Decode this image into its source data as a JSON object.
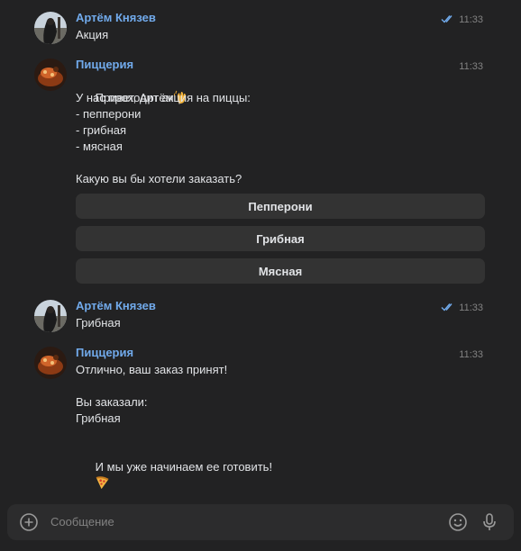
{
  "chat": {
    "messages": [
      {
        "author": "Артём Князев",
        "time": "11:33",
        "read": true,
        "text": "Акция"
      },
      {
        "author": "Пиццерия",
        "time": "11:33",
        "greeting": "Привет, Артём",
        "greeting_emoji": "waving-hand-icon",
        "body": "У нас проходит акция на пиццы:\n- пепперони\n- грибная\n- мясная\n\nКакую вы бы хотели заказать?",
        "buttons": [
          "Пепперони",
          "Грибная",
          "Мясная"
        ]
      },
      {
        "author": "Артём Князев",
        "time": "11:33",
        "read": true,
        "text": "Грибная"
      },
      {
        "author": "Пиццерия",
        "time": "11:33",
        "body": "Отлично, ваш заказ принят!\n\nВы заказали:\nГрибная\n\n",
        "last_line": "И мы уже начинаем ее готовить!",
        "last_emoji": "pizza-icon"
      }
    ]
  },
  "composer": {
    "placeholder": "Сообщение"
  },
  "colors": {
    "background": "#222223",
    "author": "#71aaeb",
    "text": "#e1e3e6",
    "muted": "#828282",
    "button": "#333333",
    "composer": "#2c2c2d"
  }
}
